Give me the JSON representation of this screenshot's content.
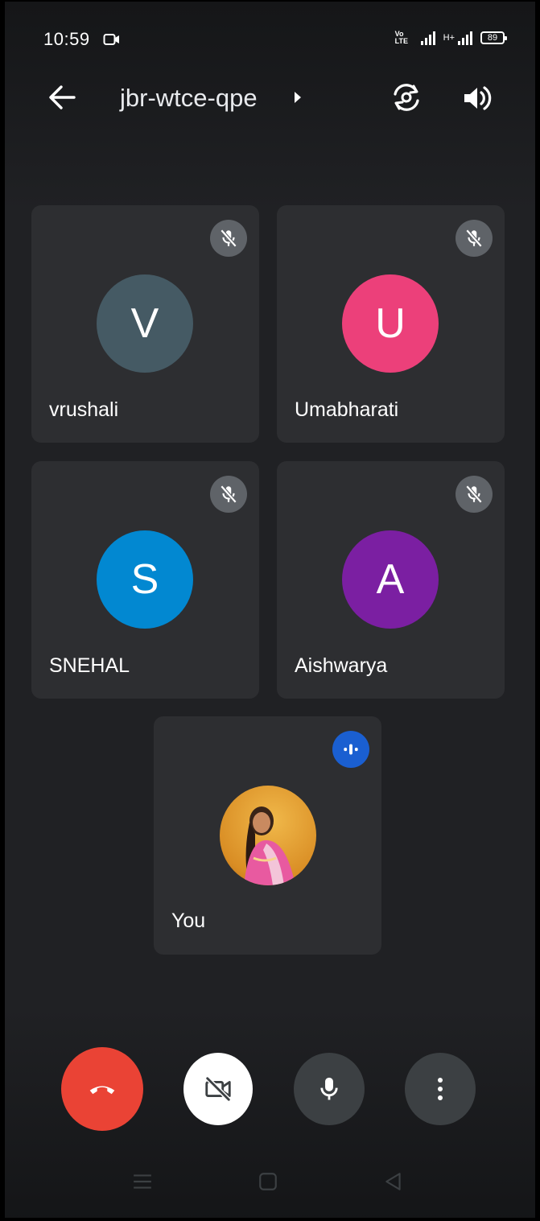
{
  "status_bar": {
    "time": "10:59",
    "volte": "Vo LTE",
    "network_type": "H+",
    "battery": "89"
  },
  "header": {
    "meeting_code": "jbr-wtce-qpe",
    "icons": [
      "back-arrow-icon",
      "caret-right-icon",
      "switch-camera-icon",
      "speaker-icon"
    ]
  },
  "participants": [
    {
      "name": "vrushali",
      "initial": "V",
      "color": "#455a64",
      "muted": true
    },
    {
      "name": "Umabharati",
      "initial": "U",
      "color": "#ec407a",
      "muted": true
    },
    {
      "name": "SNEHAL",
      "initial": "S",
      "color": "#0288d1",
      "muted": true
    },
    {
      "name": "Aishwarya",
      "initial": "A",
      "color": "#7b1fa2",
      "muted": true
    }
  ],
  "self": {
    "name": "You",
    "speaking": true
  },
  "controls": {
    "end_call_color": "#ea4335",
    "camera_button_color": "#ffffff",
    "mic_button_color": "#3c4043",
    "more_button_color": "#3c4043"
  },
  "colors": {
    "background": "#202124",
    "tile": "#2d2e31",
    "muted_badge": "#5f6368",
    "speaking_badge": "#1a5fd1"
  }
}
